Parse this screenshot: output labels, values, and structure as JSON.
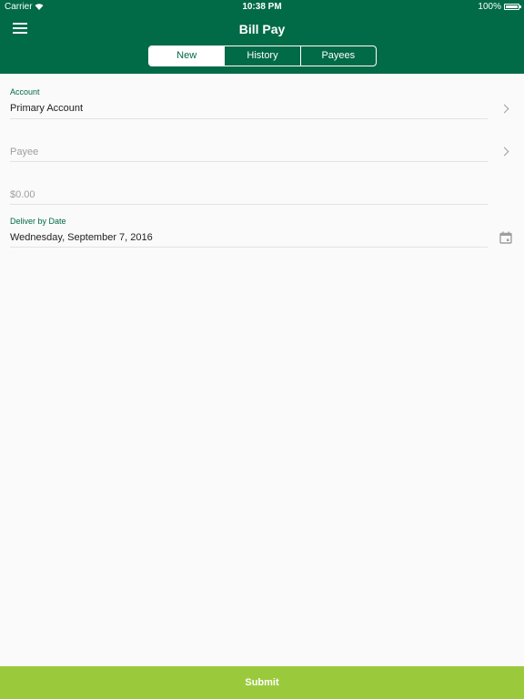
{
  "status_bar": {
    "carrier": "Carrier",
    "time": "10:38 PM",
    "battery": "100%"
  },
  "header": {
    "title": "Bill Pay",
    "tabs": [
      {
        "label": "New",
        "active": true
      },
      {
        "label": "History",
        "active": false
      },
      {
        "label": "Payees",
        "active": false
      }
    ]
  },
  "form": {
    "account_label": "Account",
    "account_value": "Primary Account",
    "payee_placeholder": "Payee",
    "amount_placeholder": "$0.00",
    "date_label": "Deliver by Date",
    "date_value": "Wednesday, September 7, 2016"
  },
  "footer": {
    "submit_label": "Submit"
  },
  "colors": {
    "header": "#016a47",
    "submit": "#9aca3c",
    "accent": "#016a47"
  }
}
